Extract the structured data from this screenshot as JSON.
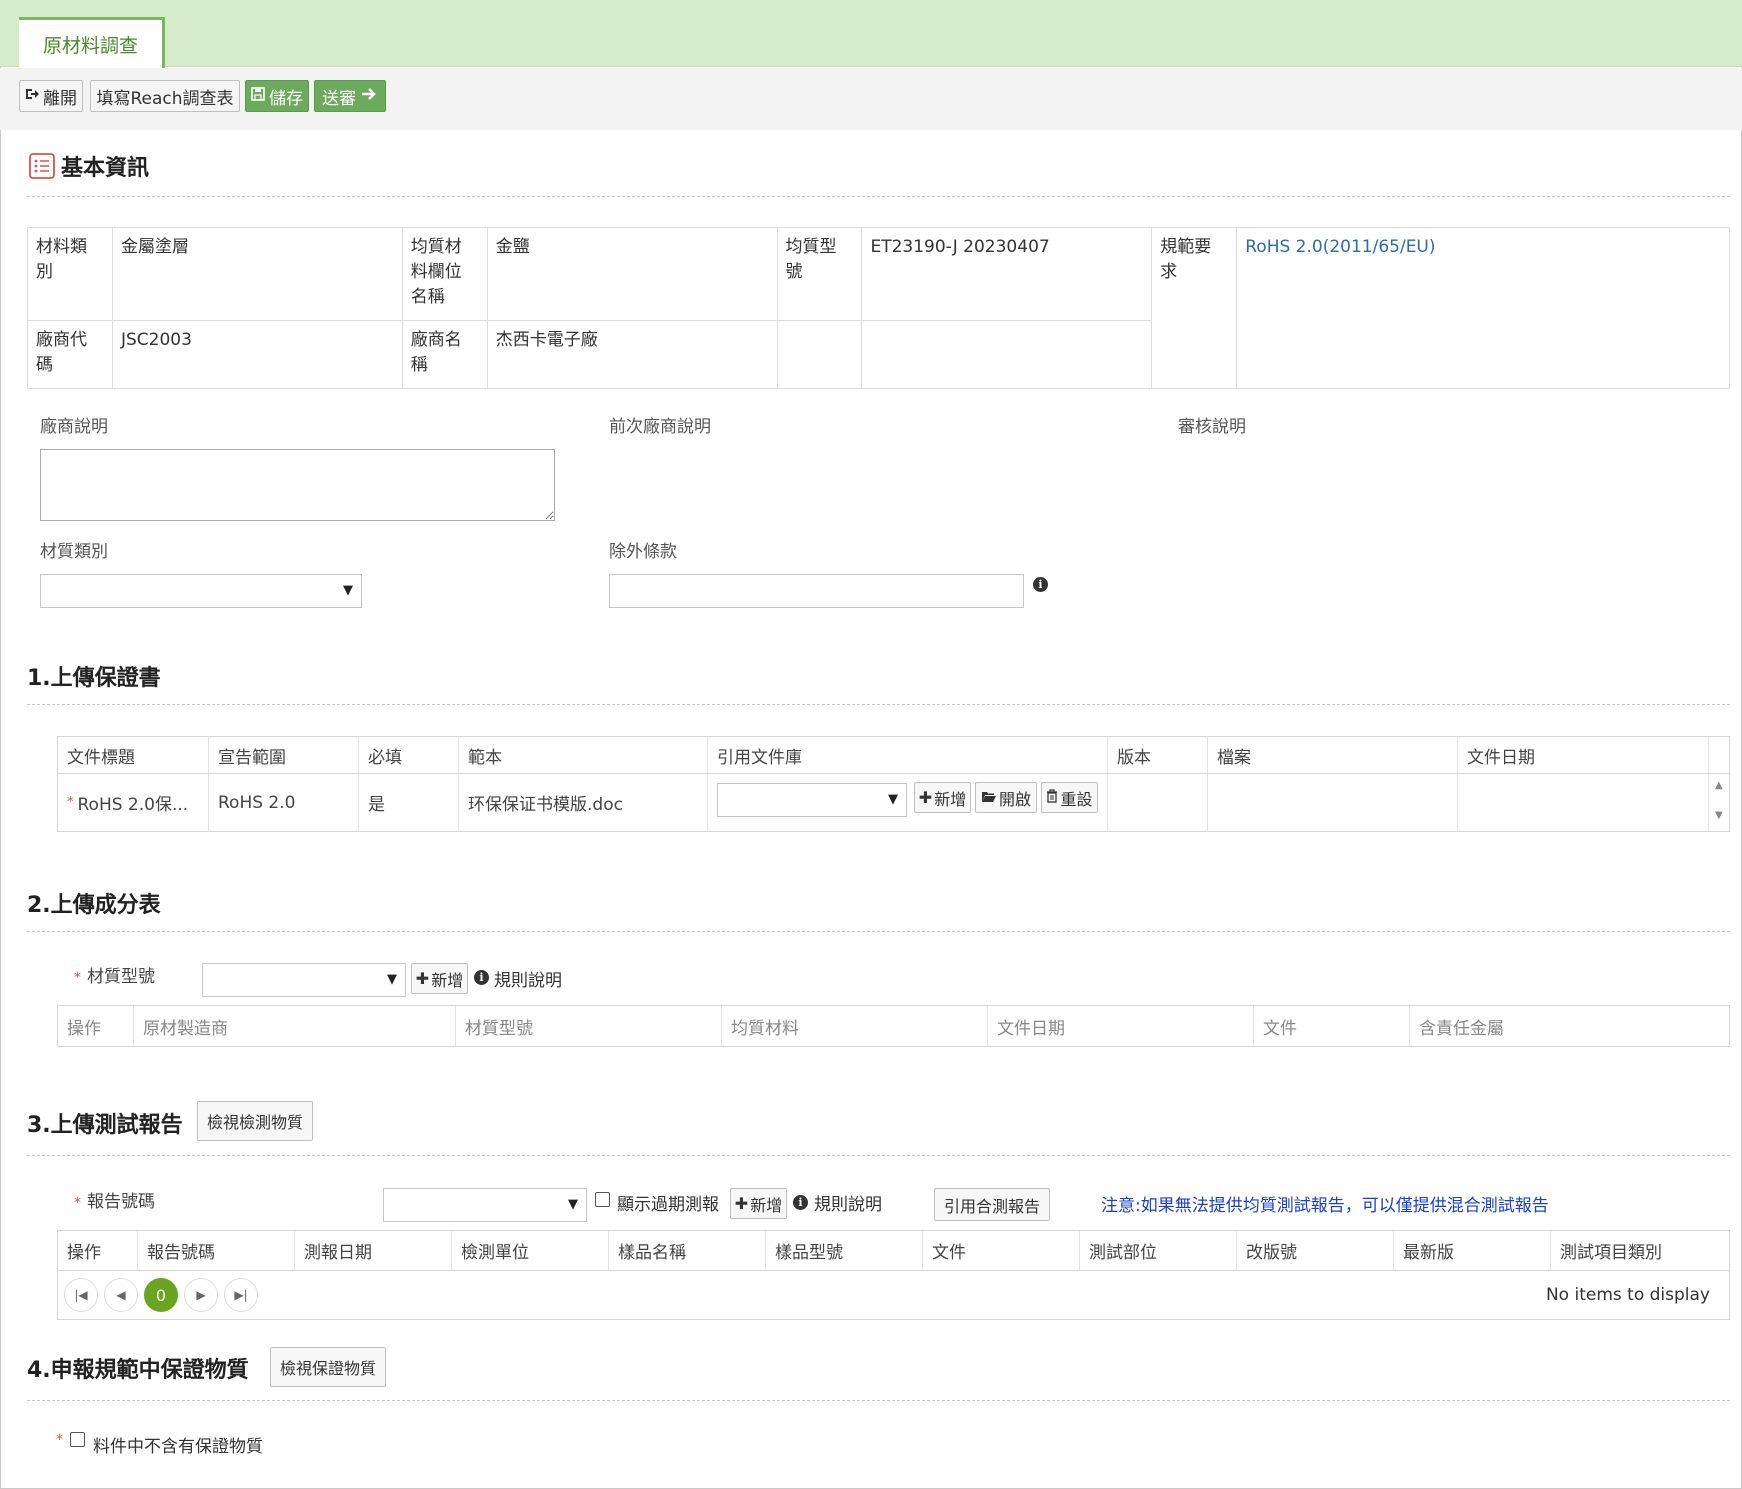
{
  "tab": {
    "label": "原材料調查"
  },
  "toolbar": {
    "leave": "離開",
    "reach": "填寫Reach調查表",
    "save": "儲存",
    "submit": "送審"
  },
  "basic": {
    "title": "基本資訊",
    "rows": [
      {
        "l1": "材料類別",
        "v1": "金屬塗層",
        "l2": "均質材料欄位名稱",
        "v2": "金鹽",
        "l3": "均質型號",
        "v3": "ET23190-J 20230407",
        "l4": "規範要求",
        "v4": "RoHS 2.0(2011/65/EU)"
      },
      {
        "l1": "廠商代碼",
        "v1": "JSC2003",
        "l2": "廠商名稱",
        "v2": "杰西卡電子廠"
      }
    ]
  },
  "fields": {
    "vendor_note": "廠商說明",
    "prev_vendor_note": "前次廠商說明",
    "review_note": "審核說明",
    "material_type": "材質類別",
    "exemption": "除外條款"
  },
  "s1": {
    "title": "1.上傳保證書",
    "headers": [
      "文件標題",
      "宣告範圍",
      "必填",
      "範本",
      "引用文件庫",
      "版本",
      "檔案",
      "文件日期"
    ],
    "row": {
      "title": "RoHS 2.0保...",
      "scope": "RoHS 2.0",
      "required": "是",
      "template": "环保保证书模版.doc"
    },
    "btn_add": "新增",
    "btn_open": "開啟",
    "btn_reset": "重設"
  },
  "s2": {
    "title": "2.上傳成分表",
    "label": "材質型號",
    "btn_add": "新增",
    "rule": "規則說明",
    "headers": [
      "操作",
      "原材製造商",
      "材質型號",
      "均質材料",
      "文件日期",
      "文件",
      "含責任金屬"
    ]
  },
  "s3": {
    "title": "3.上傳測試報告",
    "view_btn": "檢視檢測物質",
    "label": "報告號碼",
    "show_expired": "顯示過期測報",
    "btn_add": "新增",
    "rule": "規則說明",
    "cite_btn": "引用合測報告",
    "note": "注意:如果無法提供均質測試報告，可以僅提供混合測試報告",
    "headers": [
      "操作",
      "報告號碼",
      "測報日期",
      "檢測單位",
      "樣品名稱",
      "樣品型號",
      "文件",
      "測試部位",
      "改版號",
      "最新版",
      "測試項目類別"
    ],
    "page": "0",
    "empty": "No items to display"
  },
  "s4": {
    "title": "4.申報規範中保證物質",
    "view_btn": "檢視保證物質",
    "checkbox": "料件中不含有保證物質"
  },
  "colors": {
    "accent": "#6bab5b",
    "topbar": "#d6ebc9",
    "link": "#2e6da4",
    "note": "#1a3fd0",
    "pager": "#6aa520"
  }
}
